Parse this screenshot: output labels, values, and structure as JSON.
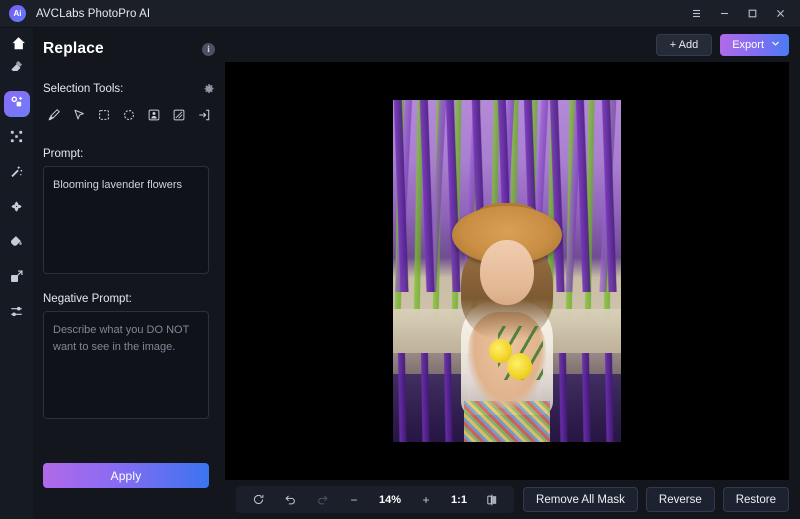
{
  "titlebar": {
    "app_name": "AVCLabs PhotoPro AI",
    "logo_text": "Ai",
    "menu_icon": "hamburger-menu-icon",
    "minimize_icon": "minimize-icon",
    "maximize_icon": "maximize-icon",
    "close_icon": "close-icon"
  },
  "rail": {
    "home_icon": "home-icon",
    "items": [
      {
        "name": "eraser-tool",
        "icon": "eraser-icon",
        "active": false
      },
      {
        "name": "replace-tool",
        "icon": "magic-replace-icon",
        "active": true
      },
      {
        "name": "expand-tool",
        "icon": "expand-corners-icon",
        "active": false
      },
      {
        "name": "enhance-tool",
        "icon": "magic-wand-icon",
        "active": false
      },
      {
        "name": "retouch-tool",
        "icon": "retouch-icon",
        "active": false
      },
      {
        "name": "colorize-tool",
        "icon": "paint-drop-icon",
        "active": false
      },
      {
        "name": "upscale-tool",
        "icon": "upscale-icon",
        "active": false
      },
      {
        "name": "adjust-tool",
        "icon": "sliders-icon",
        "active": false
      }
    ]
  },
  "panel": {
    "title": "Replace",
    "info_icon": "i",
    "selection_tools_label": "Selection Tools:",
    "gear_icon": "gear-icon",
    "tools": [
      {
        "name": "brush-tool",
        "icon": "brush-icon",
        "selected": false
      },
      {
        "name": "pointer-tool",
        "icon": "cursor-icon",
        "selected": false
      },
      {
        "name": "rectangle-select-tool",
        "icon": "square-dashed-icon",
        "selected": false
      },
      {
        "name": "ellipse-select-tool",
        "icon": "circle-dashed-icon",
        "selected": false
      },
      {
        "name": "subject-select-tool",
        "icon": "person-box-icon",
        "selected": false
      },
      {
        "name": "background-select-tool",
        "icon": "hatched-box-icon",
        "selected": false
      },
      {
        "name": "import-mask-tool",
        "icon": "arrow-into-box-icon",
        "selected": false
      }
    ],
    "prompt_label": "Prompt:",
    "prompt_value": "Blooming lavender flowers",
    "negative_prompt_label": "Negative Prompt:",
    "negative_prompt_value": "",
    "negative_prompt_placeholder": "Describe what you DO NOT want to see in the image.",
    "apply_label": "Apply"
  },
  "stage": {
    "add_label": "+ Add",
    "export_label": "Export",
    "export_caret": "chevron-down-icon",
    "image_alt": "Woman in straw hat holding yellow flowers in a lavender field"
  },
  "bottombar": {
    "reset_icon": "reset-icon",
    "undo_icon": "undo-icon",
    "redo_icon": "redo-icon",
    "zoom_out_label": "−",
    "zoom_level": "14%",
    "zoom_in_label": "+",
    "fit_ratio_label": "1:1",
    "compare_icon": "compare-split-icon",
    "remove_all_mask_label": "Remove All Mask",
    "reverse_label": "Reverse",
    "restore_label": "Restore"
  },
  "colors": {
    "accent_purple": "#8a6bf6",
    "accent_blue": "#3b74f0",
    "bg_dark": "#13161d",
    "titlebar": "#1b1f28",
    "canvas": "#000000"
  }
}
